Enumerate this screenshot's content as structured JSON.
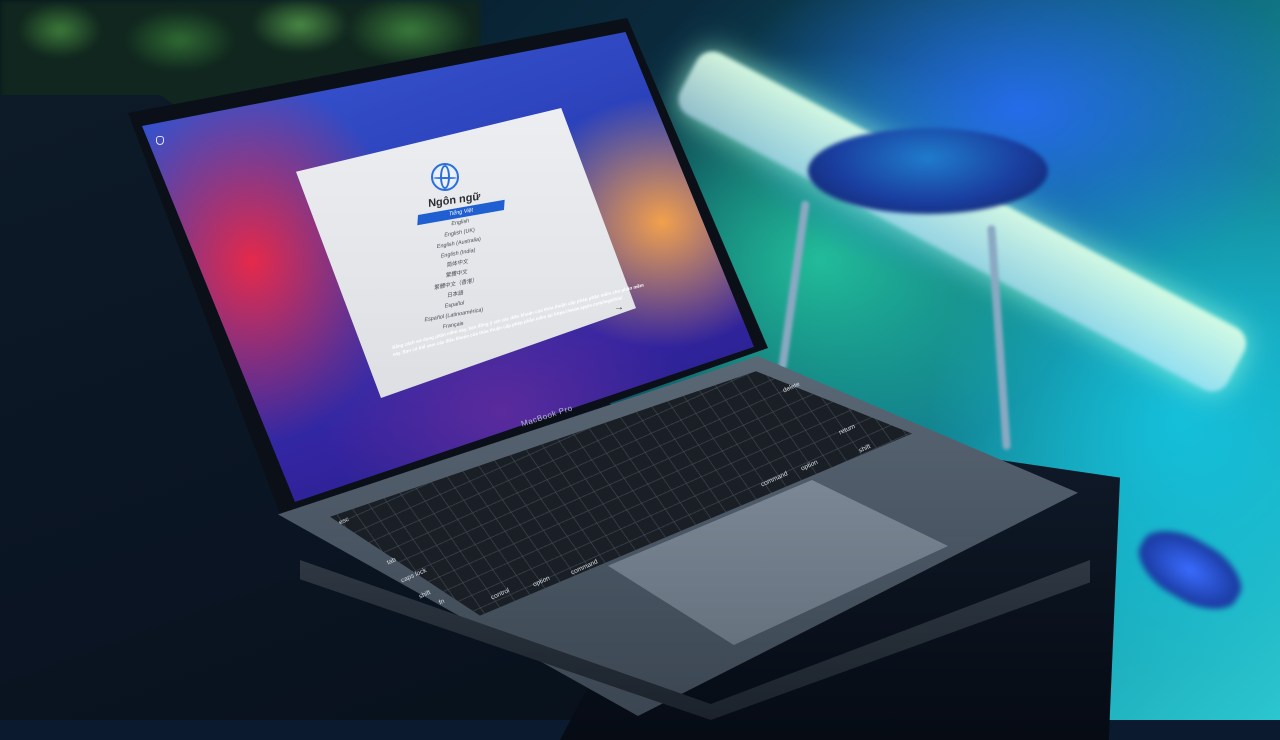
{
  "device": {
    "model_label": "MacBook Pro"
  },
  "setup_dialog": {
    "title": "Ngôn ngữ",
    "languages": [
      "Tiếng Việt",
      "English",
      "English (UK)",
      "English (Australia)",
      "English (India)",
      "简体中文",
      "繁體中文",
      "繁體中文（香港）",
      "日本語",
      "Español",
      "Español (Latinoamérica)",
      "Français"
    ],
    "selected_language": "Tiếng Việt",
    "continue_icon": "arrow-right-icon",
    "footer_note": "Bằng cách sử dụng phần mềm này, bạn đồng ý với các điều khoản của thỏa thuận cấp phép phần mềm cho phần mềm này. Bạn có thể xem các điều khoản của thỏa thuận cấp phép phần mềm tại https://www.apple.com/legal/sla/"
  },
  "keyboard": {
    "keys": [
      "esc",
      "tab",
      "caps lock",
      "shift",
      "fn",
      "control",
      "option",
      "command",
      "delete",
      "return",
      "shift",
      "option",
      "command"
    ]
  },
  "colors": {
    "selection_blue": "#1f5fd1",
    "wallpaper_red": "#e5294a",
    "wallpaper_blue": "#2a3fb8",
    "ambient_cyan": "#2bc6cf"
  }
}
